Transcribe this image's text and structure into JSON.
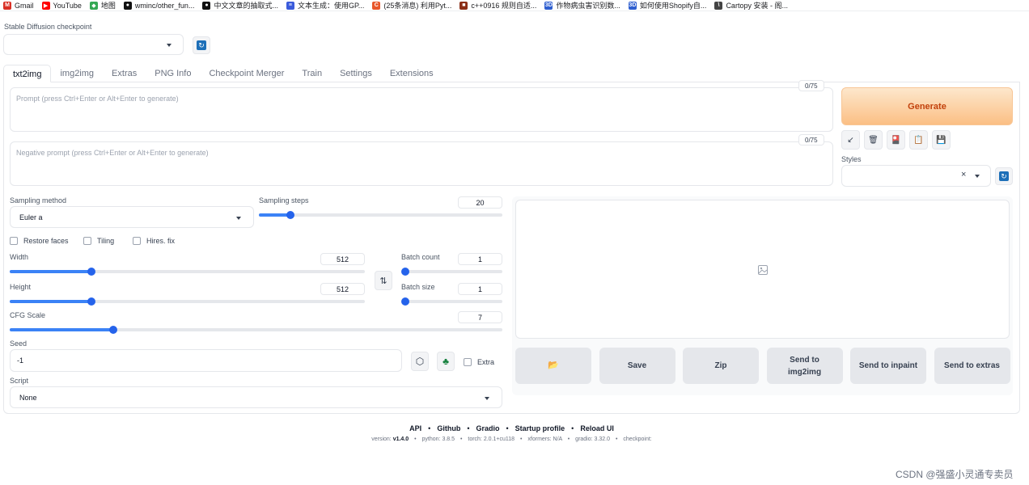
{
  "bookmarks": [
    {
      "label": "Gmail",
      "icon": "gmail-icon",
      "color": "#d93025",
      "glyph": "M"
    },
    {
      "label": "YouTube",
      "icon": "youtube-icon",
      "color": "#ff0000",
      "glyph": "▶"
    },
    {
      "label": "地图",
      "icon": "maps-icon",
      "color": "#34a853",
      "glyph": "◆"
    },
    {
      "label": "wminc/other_fun...",
      "icon": "github-icon",
      "color": "#111111",
      "glyph": "●"
    },
    {
      "label": "中文文章的抽取式...",
      "icon": "github-icon",
      "color": "#111111",
      "glyph": "●"
    },
    {
      "label": "文本生成：使用GP...",
      "icon": "paper-icon",
      "color": "#3b5bdb",
      "glyph": "≡"
    },
    {
      "label": "(25条消息) 利用Pyt...",
      "icon": "csdn-icon",
      "color": "#e8562a",
      "glyph": "C"
    },
    {
      "label": "c++0916 规则自适...",
      "icon": "bookmark-icon",
      "color": "#8b2e16",
      "glyph": "■"
    },
    {
      "label": "作物病虫害识别数...",
      "icon": "site-icon",
      "color": "#2f5fd0",
      "glyph": "3D"
    },
    {
      "label": "如何使用Shopify自...",
      "icon": "site-icon",
      "color": "#2f5fd0",
      "glyph": "3D"
    },
    {
      "label": "Cartopy 安装 - 阁...",
      "icon": "cartopy-icon",
      "color": "#444444",
      "glyph": "\\"
    }
  ],
  "checkpoint": {
    "label": "Stable Diffusion checkpoint",
    "value": ""
  },
  "tabs": [
    "txt2img",
    "img2img",
    "Extras",
    "PNG Info",
    "Checkpoint Merger",
    "Train",
    "Settings",
    "Extensions"
  ],
  "prompt": {
    "placeholder": "Prompt (press Ctrl+Enter or Alt+Enter to generate)",
    "counter": "0/75"
  },
  "negative_prompt": {
    "placeholder": "Negative prompt (press Ctrl+Enter or Alt+Enter to generate)",
    "counter": "0/75"
  },
  "generate_label": "Generate",
  "tools": [
    {
      "name": "apply-styles-icon",
      "glyph": "↙"
    },
    {
      "name": "trash-icon",
      "glyph": "🗑"
    },
    {
      "name": "extra-networks-icon",
      "glyph": "🎴"
    },
    {
      "name": "clipboard-icon",
      "glyph": "📋"
    },
    {
      "name": "save-style-icon",
      "glyph": "💾"
    }
  ],
  "styles": {
    "label": "Styles",
    "clear_glyph": "×"
  },
  "sampling_method": {
    "label": "Sampling method",
    "value": "Euler a"
  },
  "sampling_steps": {
    "label": "Sampling steps",
    "value": "20",
    "fraction": 0.13
  },
  "checkboxes": [
    "Restore faces",
    "Tiling",
    "Hires. fix"
  ],
  "width": {
    "label": "Width",
    "value": "512",
    "fraction": 0.23
  },
  "height": {
    "label": "Height",
    "value": "512",
    "fraction": 0.23
  },
  "batch_count": {
    "label": "Batch count",
    "value": "1",
    "fraction": 0.0
  },
  "batch_size": {
    "label": "Batch size",
    "value": "1",
    "fraction": 0.0
  },
  "cfg_scale": {
    "label": "CFG Scale",
    "value": "7",
    "fraction": 0.21
  },
  "seed": {
    "label": "Seed",
    "value": "-1",
    "extra_label": "Extra"
  },
  "script": {
    "label": "Script",
    "value": "None"
  },
  "actions": [
    {
      "name": "open-folder-button",
      "label": "📂"
    },
    {
      "name": "save-button",
      "label": "Save"
    },
    {
      "name": "zip-button",
      "label": "Zip"
    },
    {
      "name": "send-to-img2img-button",
      "label": "Send to img2img"
    },
    {
      "name": "send-to-inpaint-button",
      "label": "Send to inpaint"
    },
    {
      "name": "send-to-extras-button",
      "label": "Send to extras"
    }
  ],
  "footer": {
    "links": [
      "API",
      "Github",
      "Gradio",
      "Startup profile",
      "Reload UI"
    ],
    "version_prefix": "version:",
    "version": "v1.4.0",
    "python": "python: 3.8.5",
    "torch": "torch: 2.0.1+cu118",
    "xformers": "xformers: N/A",
    "gradio": "gradio: 3.32.0",
    "checkpoint": "checkpoint:"
  },
  "watermark": "CSDN @强盛小灵通专卖员",
  "colors": {
    "accent": "#2563eb",
    "generate": "#fbbf84",
    "generate_text": "#c2410c"
  }
}
